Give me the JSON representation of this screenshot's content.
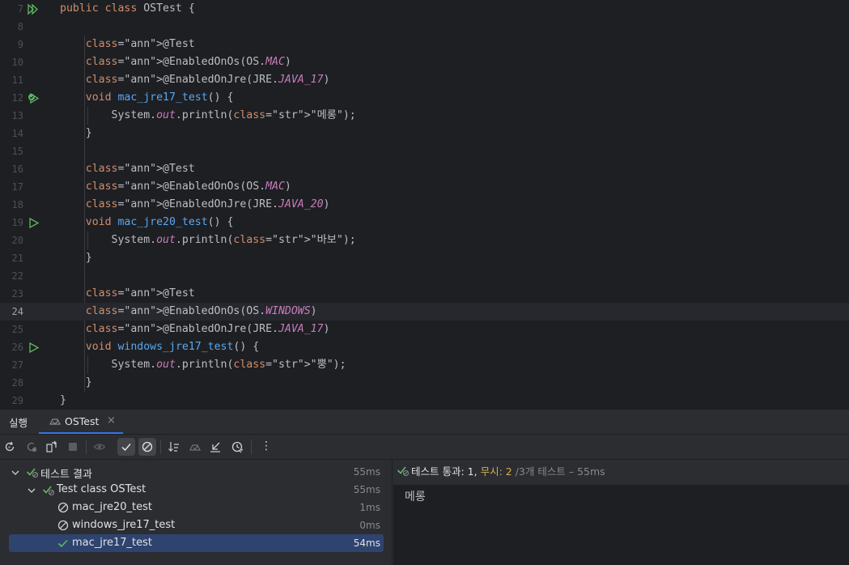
{
  "editor": {
    "lines": [
      {
        "num": "7",
        "text": "public class OSTest {"
      },
      {
        "num": "8",
        "text": ""
      },
      {
        "num": "9",
        "text": "    @Test"
      },
      {
        "num": "10",
        "text": "    @EnabledOnOs(OS.MAC)"
      },
      {
        "num": "11",
        "text": "    @EnabledOnJre(JRE.JAVA_17)"
      },
      {
        "num": "12",
        "text": "    void mac_jre17_test() {"
      },
      {
        "num": "13",
        "text": "        System.out.println(\"메롱\");"
      },
      {
        "num": "14",
        "text": "    }"
      },
      {
        "num": "15",
        "text": ""
      },
      {
        "num": "16",
        "text": "    @Test"
      },
      {
        "num": "17",
        "text": "    @EnabledOnOs(OS.MAC)"
      },
      {
        "num": "18",
        "text": "    @EnabledOnJre(JRE.JAVA_20)"
      },
      {
        "num": "19",
        "text": "    void mac_jre20_test() {"
      },
      {
        "num": "20",
        "text": "        System.out.println(\"바보\");"
      },
      {
        "num": "21",
        "text": "    }"
      },
      {
        "num": "22",
        "text": ""
      },
      {
        "num": "23",
        "text": "    @Test"
      },
      {
        "num": "24",
        "text": "    @EnabledOnOs(OS.WINDOWS)"
      },
      {
        "num": "25",
        "text": "    @EnabledOnJre(JRE.JAVA_17)"
      },
      {
        "num": "26",
        "text": "    void windows_jre17_test() {"
      },
      {
        "num": "27",
        "text": "        System.out.println(\"뿡\");"
      },
      {
        "num": "28",
        "text": "    }"
      },
      {
        "num": "29",
        "text": "}"
      }
    ],
    "current_line": "24",
    "gutter_icons": {
      "7": "run-class-icon",
      "12": "run-passed-icon",
      "19": "run-test-icon",
      "26": "run-test-icon"
    }
  },
  "tool_window": {
    "tab_run_label": "실행",
    "tab_label": "OSTest",
    "tab_close": "×",
    "toolbar_icons": [
      "rerun-icon",
      "rerun-failed-icon",
      "toggle-auto-test-icon",
      "stop-icon",
      "show-ignored-eye-icon",
      "show-passed-check-icon",
      "show-ignored-icon",
      "sort-alphabetically-icon",
      "sort-by-duration-icon",
      "import-tests-icon",
      "test-history-icon",
      "more-options-icon"
    ],
    "more_glyph": "⋮",
    "tree": [
      {
        "label": "테스트 결과",
        "time": "55ms",
        "status": "passed",
        "level": 0,
        "expandable": true
      },
      {
        "label": "Test class OSTest",
        "time": "55ms",
        "status": "passed",
        "level": 1,
        "expandable": true
      },
      {
        "label": "mac_jre20_test",
        "time": "1ms",
        "status": "ignored",
        "level": 2,
        "expandable": false
      },
      {
        "label": "windows_jre17_test",
        "time": "0ms",
        "status": "ignored",
        "level": 2,
        "expandable": false
      },
      {
        "label": "mac_jre17_test",
        "time": "54ms",
        "status": "passed-check",
        "level": 2,
        "expandable": false,
        "selected": true
      }
    ],
    "status": {
      "passed": "테스트 통과: 1,",
      "ignored": "무시: 2",
      "rest": "/3개 테스트 – 55ms"
    },
    "console_output": "메롱"
  },
  "colors": {
    "editor_bg": "#1e1f22",
    "panel_bg": "#2b2d30",
    "keyword": "#cf8e6d",
    "annotation": "#b3ae60",
    "function": "#56a8f5",
    "static_field": "#c77dbb",
    "string": "#6aab73",
    "pass": "#5fb865",
    "ignored": "#d6ae58",
    "selection": "#2e436e",
    "accent": "#3574f0"
  }
}
